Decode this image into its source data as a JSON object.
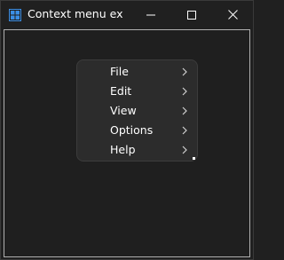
{
  "window": {
    "title": "Context menu exa..."
  },
  "context_menu": {
    "items": [
      {
        "label": "File",
        "has_submenu": true
      },
      {
        "label": "Edit",
        "has_submenu": true
      },
      {
        "label": "View",
        "has_submenu": true
      },
      {
        "label": "Options",
        "has_submenu": true
      },
      {
        "label": "Help",
        "has_submenu": true
      }
    ]
  },
  "colors": {
    "background": "#202020",
    "menu_background": "#2c2c2c",
    "text": "#ffffff",
    "app_icon": "#3a8ee6"
  }
}
